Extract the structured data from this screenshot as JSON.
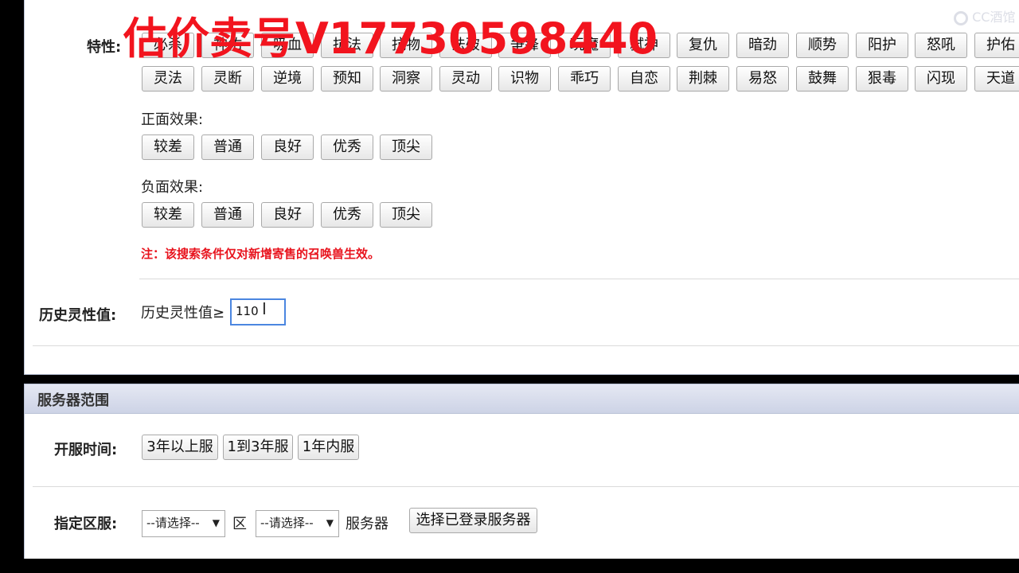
{
  "watermark": "估价卖号V17730598440",
  "logo_text": "CC酒馆",
  "traits": {
    "label": "特性:",
    "row1": [
      "必杀",
      "神佑",
      "吸血",
      "抗法",
      "抗物",
      "法破",
      "争锋",
      "玩魔",
      "弑神",
      "复仇",
      "暗劲",
      "顺势",
      "阳护",
      "怒吼",
      "护佑"
    ],
    "row2": [
      "灵法",
      "灵断",
      "逆境",
      "预知",
      "洞察",
      "灵动",
      "识物",
      "乖巧",
      "自恋",
      "荆棘",
      "易怒",
      "鼓舞",
      "狠毒",
      "闪现",
      "天道"
    ]
  },
  "positive": {
    "label": "正面效果:",
    "options": [
      "较差",
      "普通",
      "良好",
      "优秀",
      "顶尖"
    ]
  },
  "negative": {
    "label": "负面效果:",
    "options": [
      "较差",
      "普通",
      "良好",
      "优秀",
      "顶尖"
    ]
  },
  "note": "注：该搜索条件仅对新增寄售的召唤兽生效。",
  "history": {
    "label": "历史灵性值:",
    "prefix": "历史灵性值≥",
    "value": "110"
  },
  "server": {
    "section_title": "服务器范围",
    "open_time_label": "开服时间:",
    "open_time_options": [
      "3年以上服",
      "1到3年服",
      "1年内服"
    ],
    "zone_label": "指定区服:",
    "select_placeholder": "--请选择--",
    "zone_unit": "区",
    "server_unit": "服务器",
    "select_logged_button": "选择已登录服务器"
  }
}
